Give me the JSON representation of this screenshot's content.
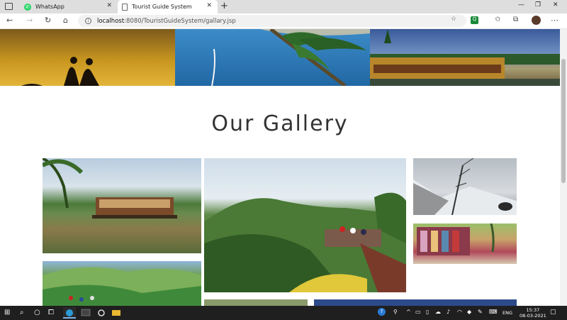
{
  "browser": {
    "tabs": [
      {
        "label": "WhatsApp",
        "active": false,
        "icon": "whatsapp-icon"
      },
      {
        "label": "Tourist Guide System",
        "active": true,
        "icon": "page-icon"
      }
    ],
    "address": {
      "host": "localhost",
      "rest": ":8080/TouristGuideSystem/gallary.jsp"
    },
    "accent": "#2b7bd6"
  },
  "page": {
    "heading": "Our Gallery"
  },
  "taskbar": {
    "language": "ENG",
    "time": "15:37",
    "date": "08-03-2021"
  }
}
